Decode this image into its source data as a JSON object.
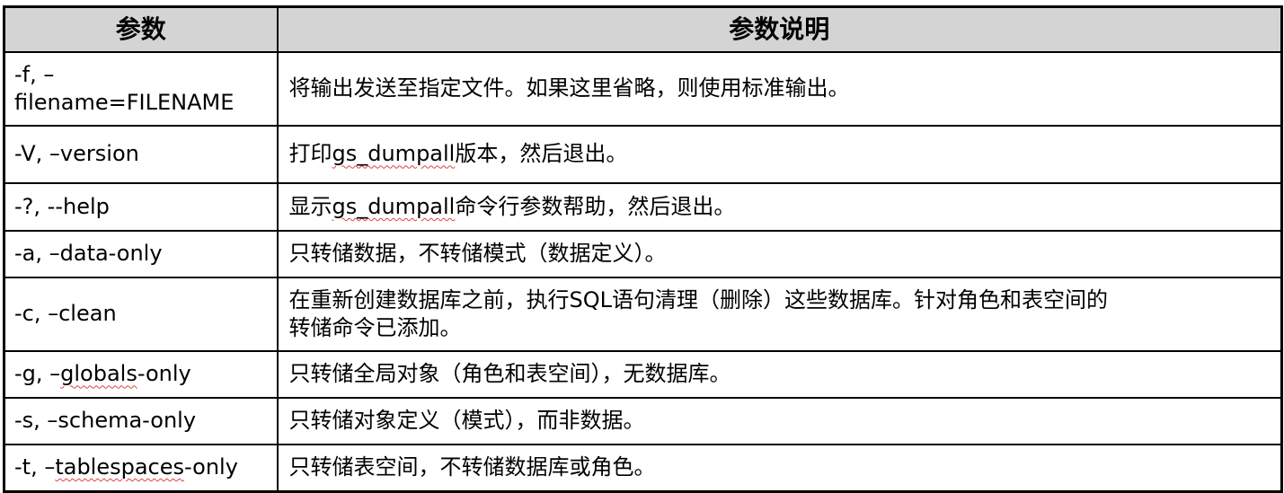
{
  "table": {
    "headers": [
      "参数",
      "参数说明"
    ],
    "rows": [
      {
        "param": "-f, –filename=FILENAME",
        "param_line1": "-f, –",
        "param_line2": "filename=FILENAME",
        "desc": "将输出发送至指定文件。如果这里省略，则使用标准输出。"
      },
      {
        "param": "-V, –version",
        "desc_pre": "打印",
        "desc_mark": "gs_dumpall",
        "desc_post": "版本，然后退出。"
      },
      {
        "param": "-?, --help",
        "desc_pre": "显示",
        "desc_mark": "gs_dumpall",
        "desc_post": "命令行参数帮助，然后退出。"
      },
      {
        "param": "-a, –data-only",
        "desc": "只转储数据，不转储模式（数据定义）。"
      },
      {
        "param": "-c, –clean",
        "desc_line1": "在重新创建数据库之前，执行SQL语句清理（删除）这些数据库。针对角色和表空间的",
        "desc_line2": "转储命令已添加。"
      },
      {
        "param": "-g, –globals-only",
        "param_pre": "-g, –",
        "param_mark": "globals",
        "param_post": "-only",
        "desc": "只转储全局对象（角色和表空间），无数据库。"
      },
      {
        "param": "-s, –schema-only",
        "desc": "只转储对象定义（模式），而非数据。"
      },
      {
        "param": "-t, –tablespaces-only",
        "param_pre": "-t, –",
        "param_mark": "tablespaces",
        "param_post": "-only",
        "desc": "只转储表空间，不转储数据库或角色。"
      }
    ]
  }
}
